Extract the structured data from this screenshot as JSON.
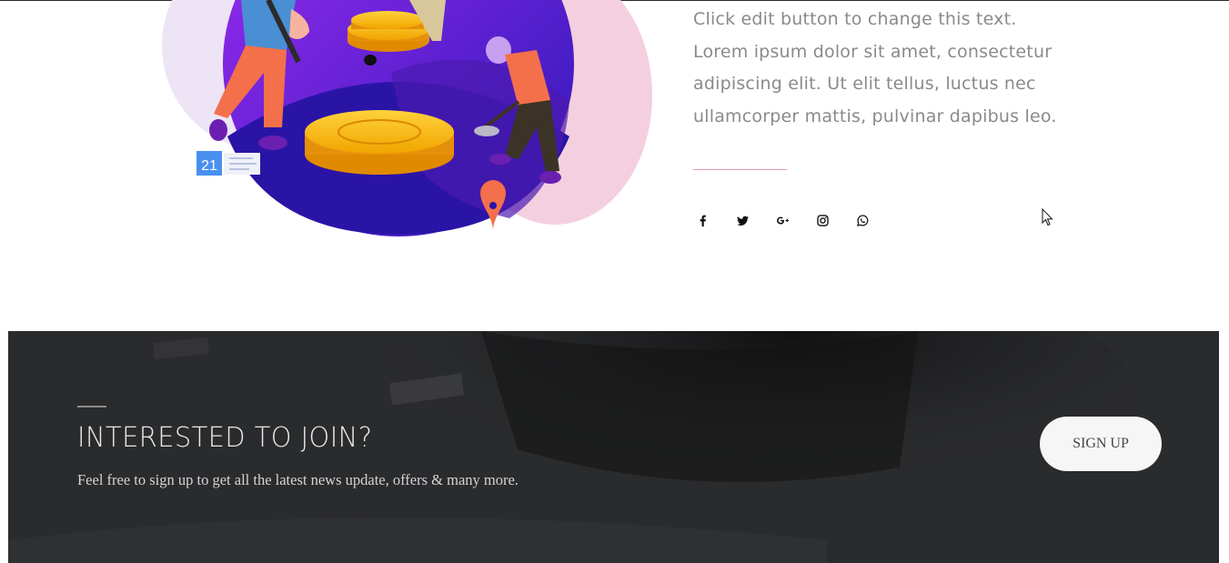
{
  "about": {
    "paragraph_lines": [
      "Click edit button to change this text.",
      "Lorem ipsum dolor sit amet, consectetur",
      "adipiscing elit. Ut elit tellus, luctus nec",
      "ullamcorper mattis, pulvinar dapibus leo."
    ],
    "calendar_badge": "21",
    "social_icons": [
      "facebook-icon",
      "twitter-icon",
      "google-plus-icon",
      "instagram-icon",
      "whatsapp-icon"
    ]
  },
  "cta": {
    "title": "INTERESTED TO JOIN?",
    "subtitle": "Feel free to sign up to get all the latest news update, offers & many more.",
    "button_label": "SIGN UP"
  },
  "colors": {
    "accent_pink": "#e79ac0",
    "illustration_purple": "#5a1fd1",
    "coin_gold": "#f2b705",
    "cta_background": "#2a2b2d"
  }
}
